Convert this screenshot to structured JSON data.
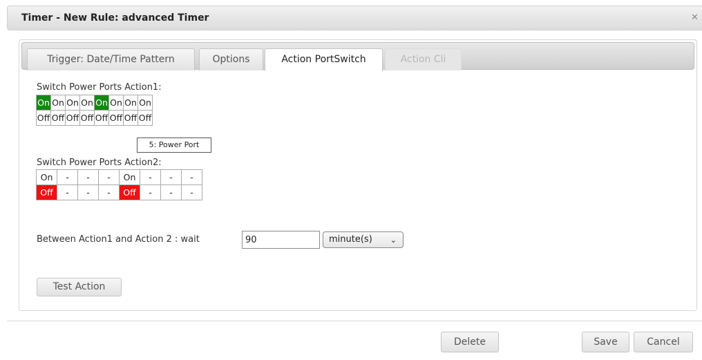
{
  "dialog": {
    "title": "Timer - New Rule: advanced Timer",
    "close_icon": "close-icon"
  },
  "tabs": [
    {
      "label": "Trigger: Date/Time Pattern",
      "state": "normal"
    },
    {
      "label": "Options",
      "state": "normal"
    },
    {
      "label": "Action PortSwitch",
      "state": "active"
    },
    {
      "label": "Action Cli",
      "state": "disabled"
    }
  ],
  "action1": {
    "label": "Switch Power Ports Action1:",
    "on_row": [
      "On",
      "On",
      "On",
      "On",
      "On",
      "On",
      "On",
      "On"
    ],
    "off_row": [
      "Off",
      "Off",
      "Off",
      "Off",
      "Off",
      "Off",
      "Off",
      "Off"
    ],
    "on_selected": [
      1,
      5
    ]
  },
  "tooltip": "5: Power Port",
  "action2": {
    "label": "Switch Power Ports Action2:",
    "on_row": [
      "On",
      "-",
      "-",
      "-",
      "On",
      "-",
      "-",
      "-"
    ],
    "off_row": [
      "Off",
      "-",
      "-",
      "-",
      "Off",
      "-",
      "-",
      "-"
    ],
    "off_selected": [
      1,
      5
    ]
  },
  "wait": {
    "label": "Between Action1 and Action 2 : wait",
    "value": "90",
    "unit": "minute(s)"
  },
  "buttons": {
    "test_action": "Test Action",
    "delete": "Delete",
    "save": "Save",
    "cancel": "Cancel"
  },
  "colors": {
    "on_active": "#118a11",
    "off_active": "#ee1212"
  }
}
